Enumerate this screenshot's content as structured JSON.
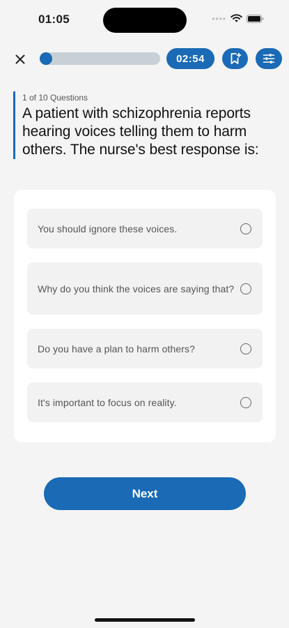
{
  "status_bar": {
    "time": "01:05",
    "icons": [
      "cellular-dots-icon",
      "wifi-icon",
      "battery-icon"
    ]
  },
  "top_bar": {
    "close_icon": "close-icon",
    "progress": {
      "current": 1,
      "total": 10,
      "fraction": 0.1
    },
    "timer": "02:54",
    "bookmark_icon": "bookmark-add-icon",
    "settings_icon": "sliders-icon"
  },
  "question": {
    "counter": "1 of 10 Questions",
    "text": "A patient with schizophrenia reports hearing voices telling them to harm others. The nurse's best response is:"
  },
  "options": [
    {
      "label": "You should ignore these voices.",
      "selected": false
    },
    {
      "label": "Why do you think the voices are saying that?",
      "selected": false
    },
    {
      "label": "Do you have a plan to harm others?",
      "selected": false
    },
    {
      "label": "It's important to focus on reality.",
      "selected": false
    }
  ],
  "next_button": {
    "label": "Next"
  },
  "colors": {
    "accent": "#1a6ab5",
    "track": "#c8d0d6",
    "background": "#f4f4f4",
    "card": "#ffffff",
    "option_bg": "#f2f2f2"
  }
}
